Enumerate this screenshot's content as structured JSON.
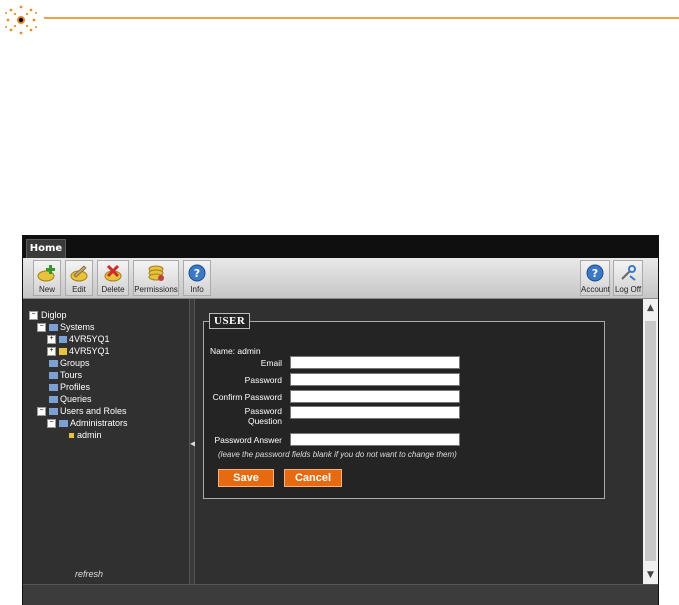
{
  "header": {
    "accent": "#f0a24a"
  },
  "tabs": [
    {
      "label": "Home"
    }
  ],
  "toolbar": {
    "buttons": [
      {
        "label": "New",
        "icon": "new-icon"
      },
      {
        "label": "Edit",
        "icon": "edit-icon"
      },
      {
        "label": "Delete",
        "icon": "delete-icon"
      },
      {
        "label": "Permissions",
        "icon": "permissions-icon"
      },
      {
        "label": "Info",
        "icon": "info-icon"
      },
      {
        "label": "Account",
        "icon": "account-icon"
      },
      {
        "label": "Log Off",
        "icon": "logoff-icon"
      }
    ]
  },
  "tree": {
    "root": "Diglop",
    "systems": "Systems",
    "system1": "4VR5YQ1",
    "system2": "4VR5YQ1",
    "groups": "Groups",
    "tours": "Tours",
    "profiles": "Profiles",
    "queries": "Queries",
    "users_and_roles": "Users and Roles",
    "administrators": "Administrators",
    "admin": "admin",
    "refresh": "refresh"
  },
  "form": {
    "legend": "USER",
    "name_line": "Name: admin",
    "email_label": "Email",
    "email_value": "",
    "password_label": "Password",
    "password_value": "",
    "confirm_label": "Confirm Password",
    "confirm_value": "",
    "question_label_1": "Password",
    "question_label_2": "Question",
    "question_value": "",
    "answer_label": "Password Answer",
    "answer_value": "",
    "note": "(leave the password fields blank if you do not want to change them)",
    "save_label": "Save",
    "cancel_label": "Cancel"
  },
  "colors": {
    "button_orange": "#e86a10",
    "panel_dark": "#303030"
  }
}
